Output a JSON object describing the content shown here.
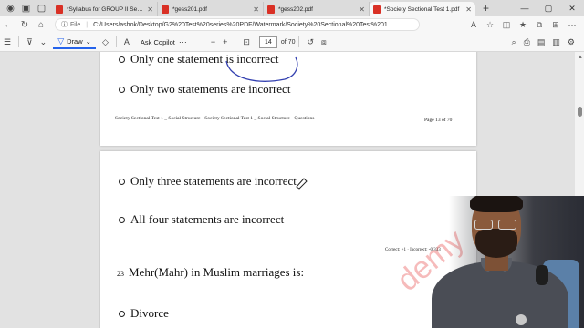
{
  "browser": {
    "tabs": [
      {
        "title": "*Syllabus for GROUP II Service",
        "active": false
      },
      {
        "title": "*gess201.pdf",
        "active": false
      },
      {
        "title": "*gess202.pdf",
        "active": false
      },
      {
        "title": "*Society Sectional Test 1.pdf",
        "active": true
      }
    ],
    "new_tab": "+",
    "address": {
      "file_label": "File",
      "url": "C:/Users/ashok/Desktop/G2%20Test%20series%20PDF/Watermark/Society%20Sectional%20Test%201..."
    }
  },
  "pdf_toolbar": {
    "draw_label": "Draw",
    "copilot_label": "Ask Copilot",
    "page_number": "14",
    "page_count": "of 70"
  },
  "document": {
    "page1": {
      "option_partial": "Only one statement is incorrect",
      "option_b": "Only two statements are incorrect",
      "footer_left": "Society Sectional Test 1 _ Social Structure · Society Sectional Test 1 _ Social Structure · Questions",
      "footer_right": "Page 13 of 70"
    },
    "page2": {
      "option_c": "Only three statements are incorrect",
      "option_d": "All four statements are incorrect",
      "marks": "Correct: +1 · Incorrect: -0.333",
      "question_number": "23",
      "question_text": "Mehr(Mahr) in Muslim marriages is:",
      "option_a": "Divorce",
      "watermark": "demy"
    }
  },
  "colors": {
    "accent": "#2563eb",
    "pdf_icon": "#d93025",
    "watermark": "#e63c3c"
  }
}
